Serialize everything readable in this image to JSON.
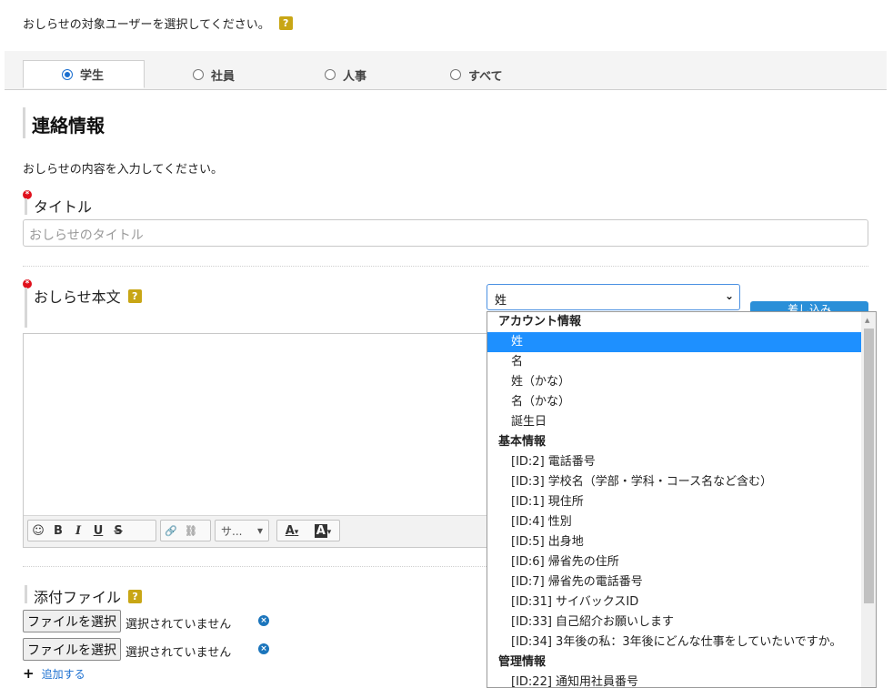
{
  "intro": {
    "text": "おしらせの対象ユーザーを選択してください。",
    "help": "?"
  },
  "tabs": [
    {
      "label": "学生",
      "selected": true
    },
    {
      "label": "社員",
      "selected": false
    },
    {
      "label": "人事",
      "selected": false
    },
    {
      "label": "すべて",
      "selected": false
    }
  ],
  "section": {
    "title": "連絡情報",
    "description": "おしらせの内容を入力してください。"
  },
  "title_field": {
    "label": "タイトル",
    "required_mark": "*",
    "placeholder": "おしらせのタイトル"
  },
  "body_field": {
    "label": "おしらせ本文",
    "required_mark": "*",
    "help": "?"
  },
  "toolbar": {
    "emoji": "☺",
    "bold": "B",
    "italic": "I",
    "underline": "U",
    "strike": "S",
    "link": "🔗",
    "unlink": "⛓",
    "size": "サ...",
    "size_arrow": "▾",
    "font_color": "A",
    "bg_color": "A",
    "arrow": "▾"
  },
  "insert_select": {
    "value": "姓",
    "button_label": "差し込み"
  },
  "dropdown": {
    "groups": [
      {
        "label": "アカウント情報",
        "items": [
          "姓",
          "名",
          "姓（かな）",
          "名（かな）",
          "誕生日"
        ]
      },
      {
        "label": "基本情報",
        "items": [
          "[ID:2] 電話番号",
          "[ID:3] 学校名（学部・学科・コース名など含む）",
          "[ID:1] 現住所",
          "[ID:4] 性別",
          "[ID:5] 出身地",
          "[ID:6] 帰省先の住所",
          "[ID:7] 帰省先の電話番号",
          "[ID:31] サイバックスID",
          "[ID:33] 自己紹介お願いします",
          "[ID:34] 3年後の私：3年後にどんな仕事をしていたいですか。"
        ]
      },
      {
        "label": "管理情報",
        "items": [
          "[ID:22] 通知用社員番号"
        ]
      }
    ],
    "selected": "姓"
  },
  "attachments": {
    "label": "添付ファイル",
    "help": "?",
    "files": [
      {
        "button": "ファイルを選択",
        "status": "選択されていません",
        "remove": "×"
      },
      {
        "button": "ファイルを選択",
        "status": "選択されていません",
        "remove": "×"
      }
    ],
    "add_icon": "+",
    "add_label": "追加する"
  }
}
